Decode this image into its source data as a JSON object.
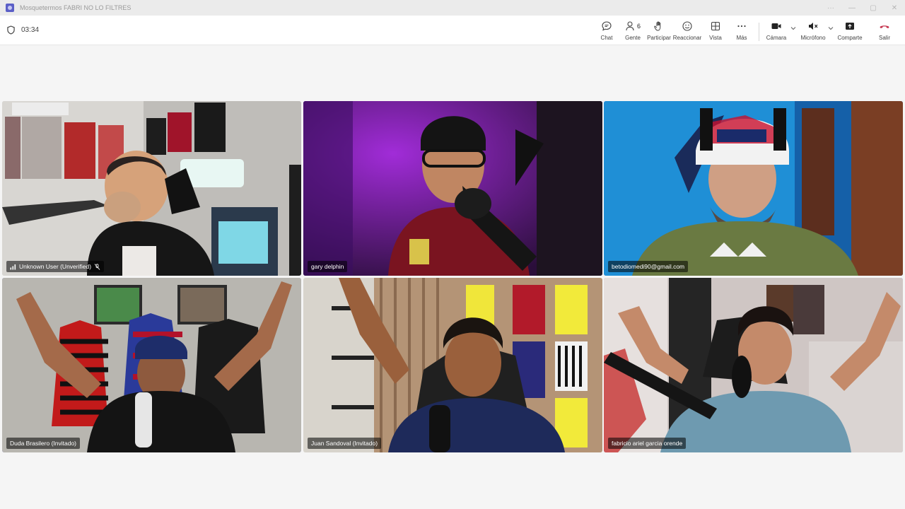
{
  "window": {
    "title": "Mosquetermos FABRI NO LO FILTRES",
    "controls": [
      "···",
      "—",
      "▢",
      "✕"
    ]
  },
  "meeting": {
    "timer": "03:34"
  },
  "toolbar": {
    "chat": "Chat",
    "people": "Gente",
    "people_count": "6",
    "raise": "Participar",
    "react": "Reaccionar",
    "view": "Vista",
    "more": "Más",
    "camera": "Cámara",
    "mic": "Micrófono",
    "share": "Comparte",
    "leave": "Salir"
  },
  "colors": {
    "accent": "#5b5fc7",
    "active_outline": "#7f85f5",
    "leave_red": "#c4314b"
  },
  "participants": [
    {
      "name": "Unknown User (Unverified)",
      "muted": true,
      "signal_icon": true
    },
    {
      "name": "gary delphin"
    },
    {
      "name": "betodiomedi90@gmail.com"
    },
    {
      "name": "Duda Brasilero (Invitado)"
    },
    {
      "name": "Juan Sandoval (Invitado)"
    },
    {
      "name": "fabricio ariel garcia orende"
    }
  ]
}
